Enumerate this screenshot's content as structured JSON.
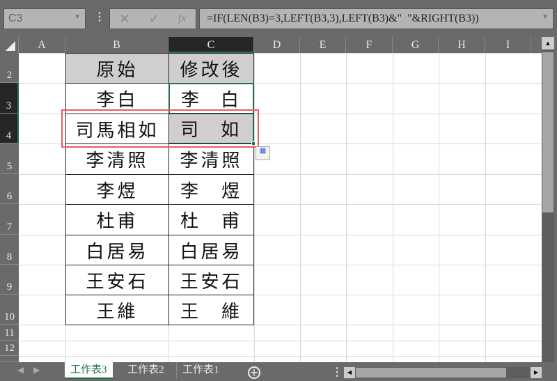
{
  "name_box": "C3",
  "formula_bar": {
    "cancel_icon": "✕",
    "enter_icon": "✓",
    "fx_label": "fx",
    "formula": "=IF(LEN(B3)=3,LEFT(B3,3),LEFT(B3)&\"  \"&RIGHT(B3))"
  },
  "columns": [
    "A",
    "B",
    "C",
    "D",
    "E",
    "F",
    "G",
    "H",
    "I"
  ],
  "rows": [
    "2",
    "3",
    "4",
    "5",
    "6",
    "7",
    "8",
    "9",
    "10",
    "11",
    "12"
  ],
  "table": {
    "headers": [
      "原始",
      "修改後"
    ],
    "rows": [
      {
        "original": "李白",
        "modified": [
          "李",
          "白"
        ]
      },
      {
        "original": "司馬相如",
        "modified": [
          "司",
          "如"
        ]
      },
      {
        "original": "李清照",
        "modified": [
          "李清照"
        ]
      },
      {
        "original": "李煜",
        "modified": [
          "李",
          "煜"
        ]
      },
      {
        "original": "杜甫",
        "modified": [
          "杜",
          "甫"
        ]
      },
      {
        "original": "白居易",
        "modified": [
          "白居易"
        ]
      },
      {
        "original": "王安石",
        "modified": [
          "王安石"
        ]
      },
      {
        "original": "王維",
        "modified": [
          "王",
          "維"
        ]
      }
    ]
  },
  "sheets": [
    "工作表3",
    "工作表2",
    "工作表1"
  ],
  "active_sheet": "工作表3",
  "colors": {
    "accent": "#217346",
    "highlight": "#f05a5a"
  }
}
